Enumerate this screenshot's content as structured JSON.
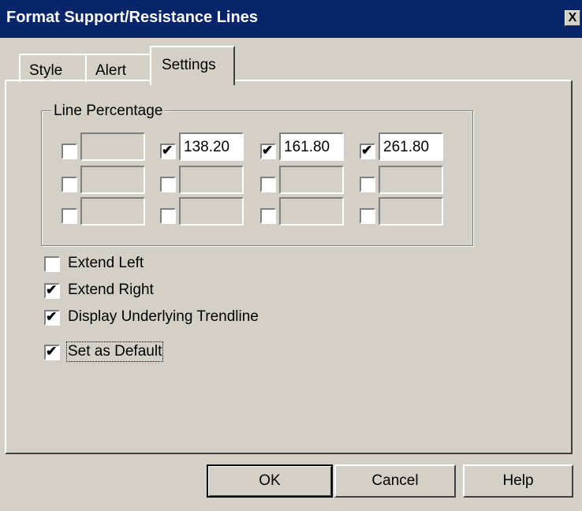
{
  "window": {
    "title": "Format Support/Resistance Lines",
    "close_symbol": "X"
  },
  "tabs": [
    {
      "label": "Style",
      "active": false
    },
    {
      "label": "Alert",
      "active": false
    },
    {
      "label": "Settings",
      "active": true
    }
  ],
  "line_percentage": {
    "label": "Line Percentage",
    "rows": [
      [
        {
          "checked": false,
          "value": ""
        },
        {
          "checked": true,
          "value": "138.20"
        },
        {
          "checked": true,
          "value": "161.80"
        },
        {
          "checked": true,
          "value": "261.80"
        }
      ],
      [
        {
          "checked": false,
          "value": ""
        },
        {
          "checked": false,
          "value": ""
        },
        {
          "checked": false,
          "value": ""
        },
        {
          "checked": false,
          "value": ""
        }
      ],
      [
        {
          "checked": false,
          "value": ""
        },
        {
          "checked": false,
          "value": ""
        },
        {
          "checked": false,
          "value": ""
        },
        {
          "checked": false,
          "value": ""
        }
      ]
    ]
  },
  "options": [
    {
      "label": "Extend Left",
      "checked": false
    },
    {
      "label": "Extend Right",
      "checked": true
    },
    {
      "label": "Display Underlying Trendline",
      "checked": true
    },
    {
      "label": "Set as Default",
      "checked": true
    }
  ],
  "buttons": {
    "ok": "OK",
    "cancel": "Cancel",
    "help": "Help"
  }
}
